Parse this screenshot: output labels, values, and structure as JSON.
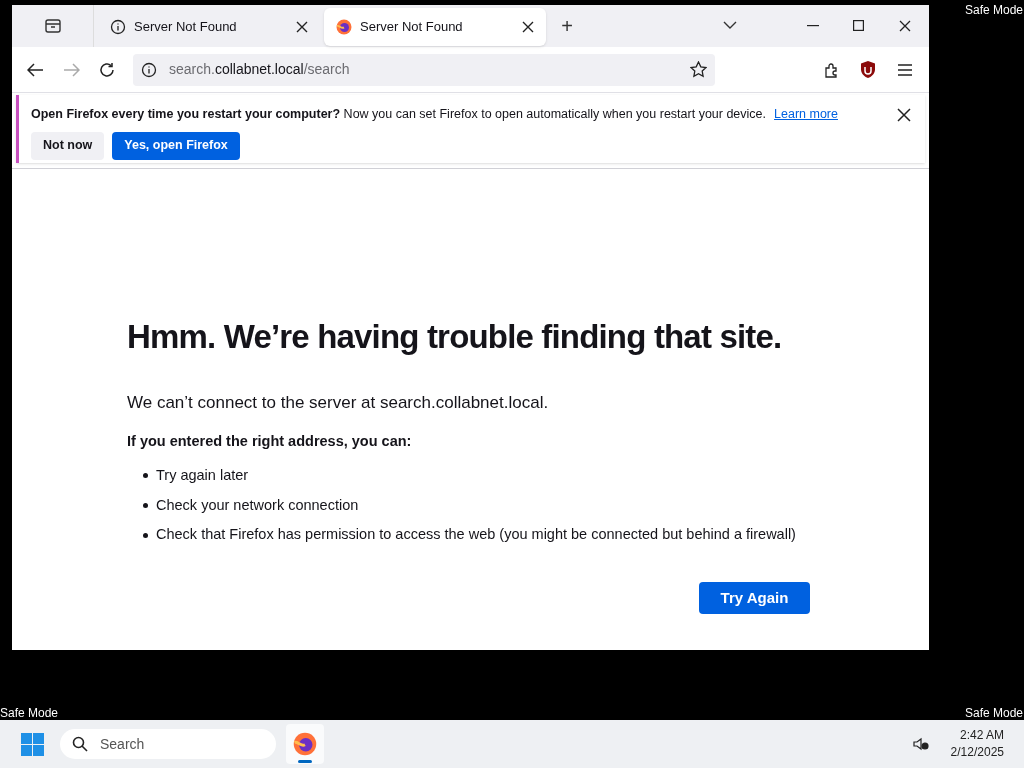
{
  "desktop": {
    "top_right_label": "Safe Mode",
    "bottom_left_label": "Safe Mode",
    "bottom_right_label": "Safe Mode"
  },
  "tabs": [
    {
      "title": "Server Not Found",
      "selected": false
    },
    {
      "title": "Server Not Found",
      "selected": true
    }
  ],
  "new_tab": "+",
  "address_bar": {
    "url_parts": [
      {
        "text": "search.",
        "emphasis": false
      },
      {
        "text": "collabnet.local",
        "emphasis": true
      },
      {
        "text": "/search",
        "emphasis": false
      }
    ]
  },
  "notification": {
    "message": "**Open Firefox every time you restart your computer?** Now you can set Firefox to open automatically when you restart your device.",
    "link": "Learn more",
    "buttons": [
      {
        "label": "Not now",
        "primary": false
      },
      {
        "label": "Yes, open Firefox",
        "primary": true
      }
    ]
  },
  "error_page": {
    "title": "Hmm. We’re having trouble finding that site.",
    "description": "We can’t connect to the server at search.collabnet.local.",
    "subheading": "If you entered the right address, you can:",
    "suggestions": [
      "Try again later",
      "Check your network connection",
      "Check that Firefox has permission to access the web (you might be connected but behind a firewall)"
    ],
    "button": "Try Again"
  },
  "taskbar": {
    "search_placeholder": "Search",
    "time": "2:42 AM",
    "date": "2/12/2025"
  }
}
